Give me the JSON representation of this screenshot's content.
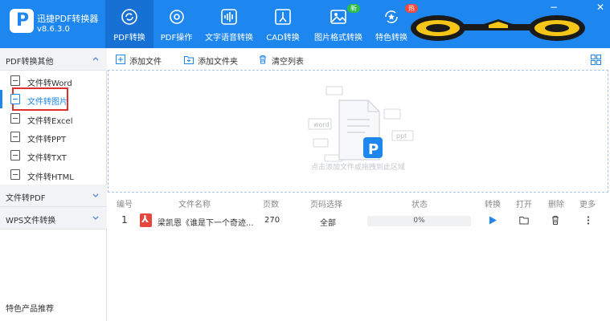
{
  "app": {
    "title": "迅捷PDF转换器",
    "version": "v8.6.3.0"
  },
  "nav": [
    {
      "label": "PDF转换",
      "icon": "refresh-pdf-icon",
      "active": true
    },
    {
      "label": "PDF操作",
      "icon": "gear-icon",
      "active": false
    },
    {
      "label": "文字语音转换",
      "icon": "waveform-icon",
      "active": false
    },
    {
      "label": "CAD转换",
      "icon": "cad-icon",
      "active": false
    },
    {
      "label": "图片格式转换",
      "icon": "image-icon",
      "active": false,
      "badge": "新"
    },
    {
      "label": "特色转换",
      "icon": "star-refresh-icon",
      "active": false,
      "badge": "热"
    }
  ],
  "window_controls": {
    "minimize": "−",
    "close": "✕"
  },
  "sidebar": {
    "section1": "PDF转换其他",
    "items": [
      {
        "label": "文件转Word",
        "icon": "file-word-icon"
      },
      {
        "label": "文件转图片",
        "icon": "file-image-icon",
        "selected": true
      },
      {
        "label": "文件转Excel",
        "icon": "file-excel-icon"
      },
      {
        "label": "文件转PPT",
        "icon": "file-ppt-icon"
      },
      {
        "label": "文件转TXT",
        "icon": "file-txt-icon"
      },
      {
        "label": "文件转HTML",
        "icon": "file-html-icon"
      }
    ],
    "section2": "文件转PDF",
    "section3": "WPS文件转换",
    "featured": "特色产品推荐"
  },
  "toolbar": {
    "add_file": "添加文件",
    "add_folder": "添加文件夹",
    "clear_list": "清空列表"
  },
  "dropzone": {
    "hint": "点击添加文件或拖拽到此区域",
    "labels": {
      "word": "word",
      "ppt": "ppt",
      "a": "txt",
      "b": "pdf"
    }
  },
  "table": {
    "headers": [
      "编号",
      "文件名称",
      "页数",
      "页码选择",
      "状态",
      "转换",
      "打开",
      "删除",
      "更多"
    ],
    "rows": [
      {
        "index": "1",
        "name": "梁凯恩《谁是下一个奇迹...",
        "pages": "270",
        "range": "全部",
        "progress_text": "0%",
        "progress": 0
      }
    ]
  },
  "colors": {
    "brand": "#1e86ef",
    "selected_outline": "#e02f2f",
    "pdf_red": "#e5463e"
  }
}
